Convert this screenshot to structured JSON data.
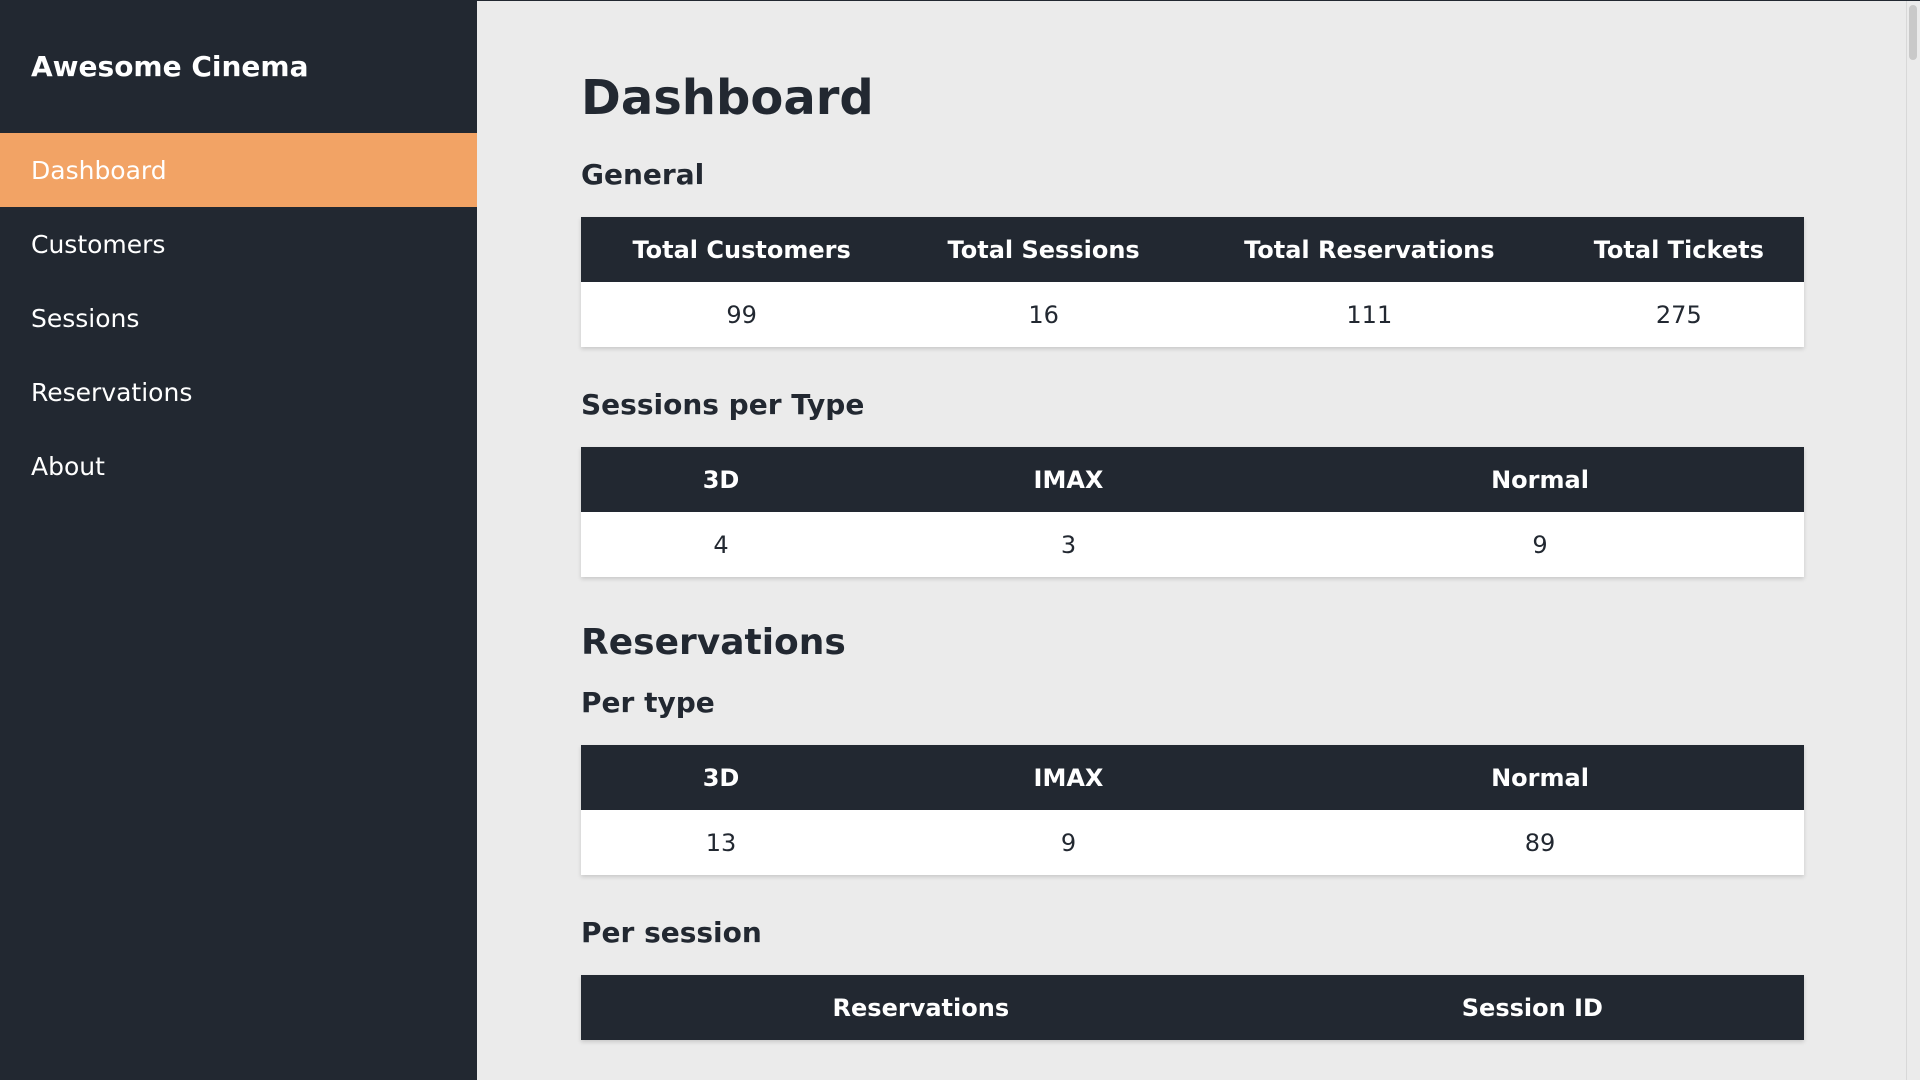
{
  "sidebar": {
    "brand": "Awesome Cinema",
    "items": [
      {
        "label": "Dashboard",
        "active": true
      },
      {
        "label": "Customers"
      },
      {
        "label": "Sessions"
      },
      {
        "label": "Reservations"
      },
      {
        "label": "About"
      }
    ]
  },
  "main": {
    "title": "Dashboard",
    "general": {
      "title": "General",
      "headers": [
        "Total Customers",
        "Total Sessions",
        "Total Reservations",
        "Total Tickets"
      ],
      "values": [
        "99",
        "16",
        "111",
        "275"
      ]
    },
    "sessions_per_type": {
      "title": "Sessions per Type",
      "headers": [
        "3D",
        "IMAX",
        "Normal"
      ],
      "values": [
        "4",
        "3",
        "9"
      ]
    },
    "reservations": {
      "title": "Reservations",
      "per_type": {
        "title": "Per type",
        "headers": [
          "3D",
          "IMAX",
          "Normal"
        ],
        "values": [
          "13",
          "9",
          "89"
        ]
      },
      "per_session": {
        "title": "Per session",
        "headers": [
          "Reservations",
          "Session ID"
        ]
      }
    }
  },
  "colors": {
    "sidebar_bg": "#222831",
    "active_bg": "#f2a365",
    "page_bg": "#ebebeb",
    "header_bg": "#222831"
  }
}
